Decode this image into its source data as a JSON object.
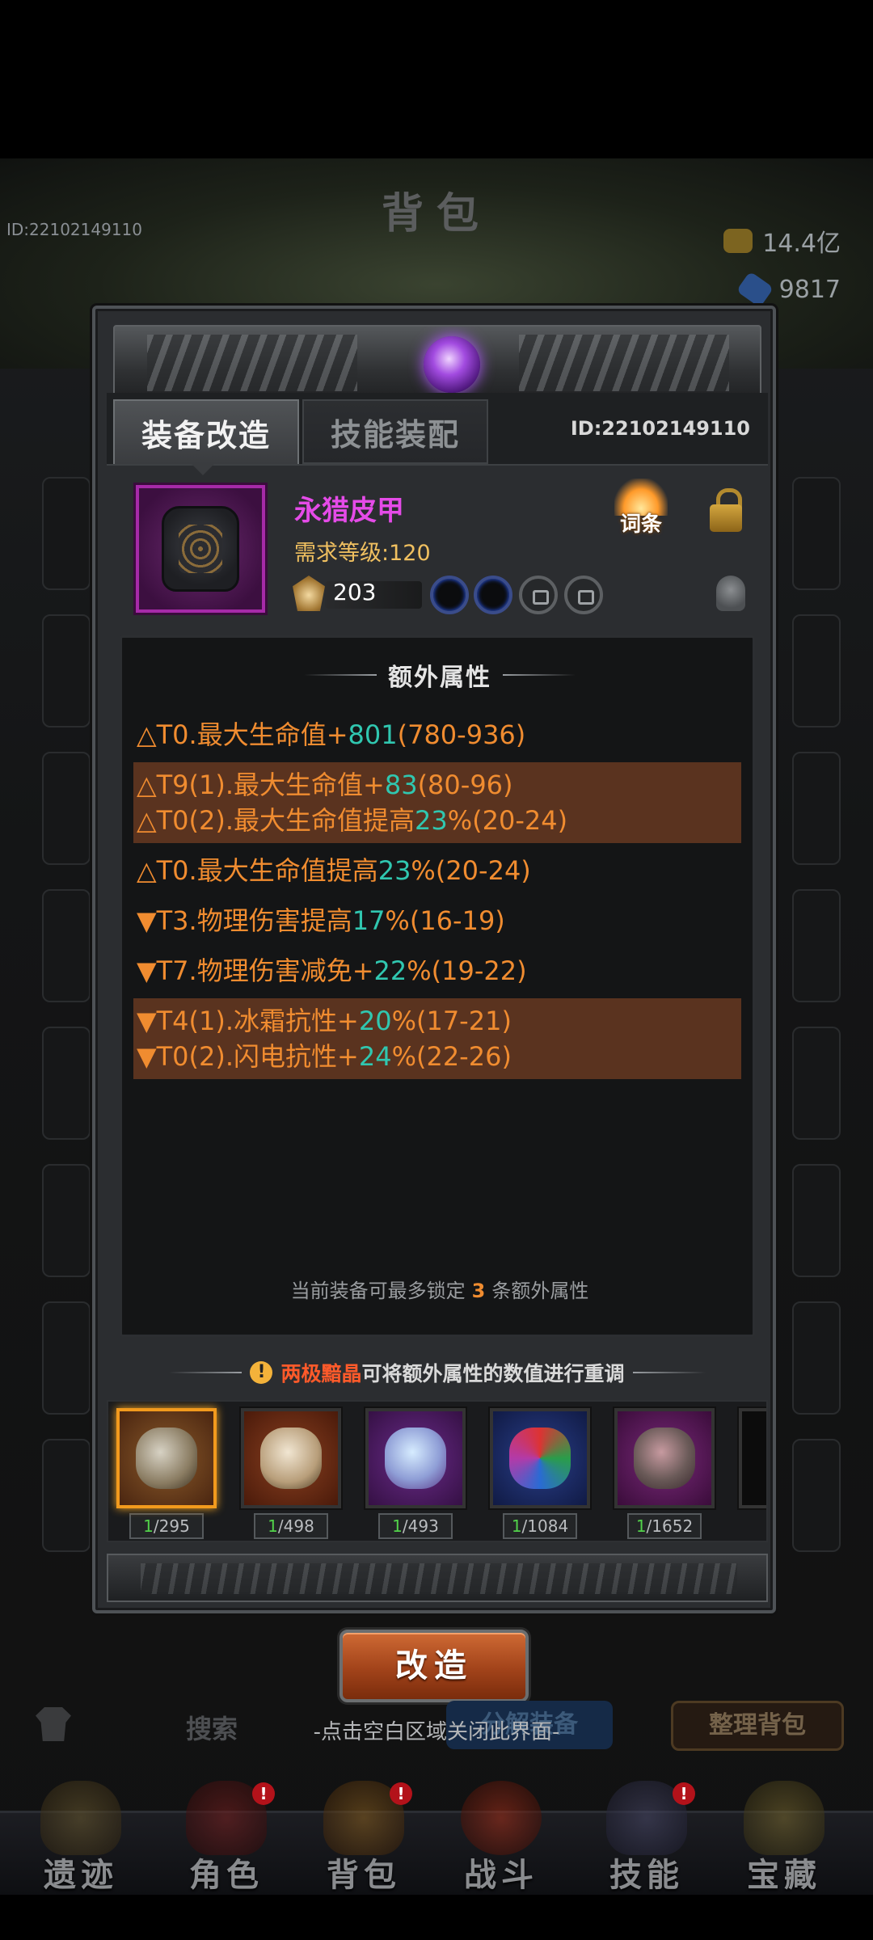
{
  "background": {
    "title": "背包",
    "player_id": "ID:22102149110",
    "gold": "14.4亿",
    "gems": "9817",
    "search_label": "搜索",
    "disassemble_label": "分解装备",
    "sort_label": "整理背包",
    "close_hint": "-点击空白区域关闭此界面-"
  },
  "dialog": {
    "tabs": [
      {
        "label": "装备改造",
        "active": true
      },
      {
        "label": "技能装配",
        "active": false
      }
    ],
    "id_label": "ID:22102149110",
    "item": {
      "name": "永猎皮甲",
      "name_color": "#e54be8",
      "level_req": "需求等级:120",
      "power": "203",
      "sockets": [
        "empty",
        "empty",
        "locked",
        "locked"
      ]
    },
    "entry_button": "词条",
    "attributes_title": "额外属性",
    "attribute_groups": [
      {
        "highlighted": false,
        "lines": [
          {
            "pre": "△T0.最大生命值+",
            "val": "801",
            "post": "(780-936)"
          }
        ]
      },
      {
        "highlighted": true,
        "lines": [
          {
            "pre": "△T9(1).最大生命值+",
            "val": "83",
            "post": "(80-96)"
          },
          {
            "pre": "△T0(2).最大生命值提高",
            "val": "23",
            "post": "%(20-24)"
          }
        ]
      },
      {
        "highlighted": false,
        "lines": [
          {
            "pre": "△T0.最大生命值提高",
            "val": "23",
            "post": "%(20-24)"
          }
        ]
      },
      {
        "highlighted": false,
        "lines": [
          {
            "pre": "▼T3.物理伤害提高",
            "val": "17",
            "post": "%(16-19)"
          }
        ]
      },
      {
        "highlighted": false,
        "lines": [
          {
            "pre": "▼T7.物理伤害减免+",
            "val": "22",
            "post": "%(19-22)"
          }
        ]
      },
      {
        "highlighted": true,
        "lines": [
          {
            "pre": "▼T4(1).冰霜抗性+",
            "val": "20",
            "post": "%(17-21)"
          },
          {
            "pre": "▼T0(2).闪电抗性+",
            "val": "24",
            "post": "%(22-26)"
          }
        ]
      }
    ],
    "lock_note": {
      "before": "当前装备可最多锁定",
      "count": "3",
      "after": "条额外属性"
    },
    "material_hint": {
      "warn_icon": "!",
      "highlight": "两极黯晶",
      "rest": "可将额外属性的数值进行重调"
    },
    "materials": [
      {
        "icon": "yin-yang-crystal-icon",
        "have": "1",
        "total": "/295",
        "selected": true
      },
      {
        "icon": "twin-mask-icon",
        "have": "1",
        "total": "/498",
        "selected": false
      },
      {
        "icon": "ice-geode-icon",
        "have": "1",
        "total": "/493",
        "selected": false
      },
      {
        "icon": "prism-ore-icon",
        "have": "1",
        "total": "/1084",
        "selected": false
      },
      {
        "icon": "crimson-ore-icon",
        "have": "1",
        "total": "/1652",
        "selected": false
      }
    ],
    "modify_button": "改造"
  },
  "nav": [
    {
      "label": "遗迹",
      "badge": ""
    },
    {
      "label": "角色",
      "badge": "!"
    },
    {
      "label": "背包",
      "badge": "!"
    },
    {
      "label": "战斗",
      "badge": ""
    },
    {
      "label": "技能",
      "badge": "!"
    },
    {
      "label": "宝藏",
      "badge": ""
    }
  ],
  "colors": {
    "attribute_text": "#f08c30",
    "attribute_value": "#30c7b0",
    "highlight_row": "#5a331f",
    "epic_purple": "#e54be8"
  }
}
